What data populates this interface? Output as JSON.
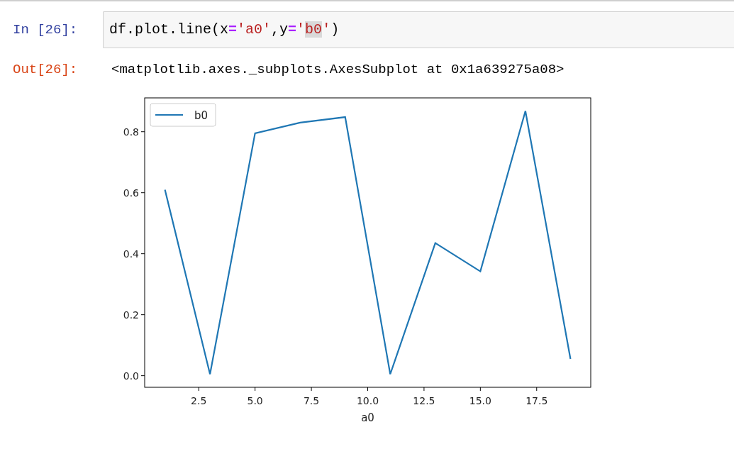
{
  "input_cell": {
    "prompt": "In [26]:",
    "code": [
      {
        "text": "df.plot.line(x",
        "kind": "plain",
        "highlighted": false
      },
      {
        "text": "=",
        "kind": "operator",
        "highlighted": false
      },
      {
        "text": "'a0'",
        "kind": "string",
        "highlighted": false
      },
      {
        "text": ",y",
        "kind": "plain",
        "highlighted": false
      },
      {
        "text": "=",
        "kind": "operator",
        "highlighted": false
      },
      {
        "text": "'",
        "kind": "string",
        "highlighted": false
      },
      {
        "text": "b0",
        "kind": "string",
        "highlighted": true
      },
      {
        "text": "'",
        "kind": "string",
        "highlighted": false
      },
      {
        "text": ")",
        "kind": "plain",
        "highlighted": false
      }
    ]
  },
  "output_cell": {
    "prompt": "Out[26]:",
    "text": "<matplotlib.axes._subplots.AxesSubplot at 0x1a639275a08>",
    "chart_data": {
      "type": "line",
      "xlabel": "a0",
      "x": [
        1,
        3,
        5,
        7,
        9,
        11,
        13,
        15,
        17,
        19
      ],
      "series": [
        {
          "name": "b0",
          "color": "#1f77b4",
          "values": [
            0.61,
            0.005,
            0.795,
            0.83,
            0.848,
            0.005,
            0.435,
            0.342,
            0.868,
            0.055
          ]
        }
      ],
      "xlim": [
        0.1,
        19.9
      ],
      "ylim": [
        -0.038,
        0.911
      ],
      "xticks": [
        {
          "value": 2.5,
          "label": "2.5"
        },
        {
          "value": 5,
          "label": "5.0"
        },
        {
          "value": 7.5,
          "label": "7.5"
        },
        {
          "value": 10,
          "label": "10.0"
        },
        {
          "value": 12.5,
          "label": "12.5"
        },
        {
          "value": 15,
          "label": "15.0"
        },
        {
          "value": 17.5,
          "label": "17.5"
        }
      ],
      "yticks": [
        {
          "value": 0,
          "label": "0.0"
        },
        {
          "value": 0.2,
          "label": "0.2"
        },
        {
          "value": 0.4,
          "label": "0.4"
        },
        {
          "value": 0.6,
          "label": "0.6"
        },
        {
          "value": 0.8,
          "label": "0.8"
        }
      ]
    }
  }
}
